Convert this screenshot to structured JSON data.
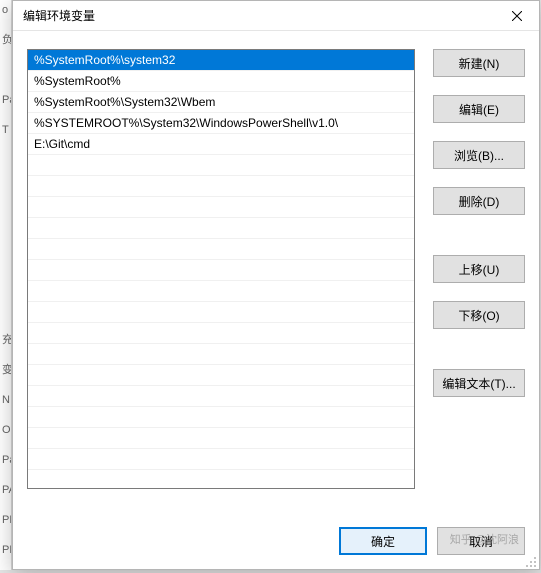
{
  "dialog": {
    "title": "编辑环境变量"
  },
  "list": {
    "items": [
      "%SystemRoot%\\system32",
      "%SystemRoot%",
      "%SystemRoot%\\System32\\Wbem",
      "%SYSTEMROOT%\\System32\\WindowsPowerShell\\v1.0\\",
      "E:\\Git\\cmd"
    ],
    "selected_index": 0,
    "visible_rows": 20
  },
  "buttons": {
    "new": "新建(N)",
    "edit": "编辑(E)",
    "browse": "浏览(B)...",
    "delete": "删除(D)",
    "move_up": "上移(U)",
    "move_down": "下移(O)",
    "edit_text": "编辑文本(T)...",
    "ok": "确定",
    "cancel": "取消"
  },
  "watermark": "知乎 @沈阿浪",
  "bg_fragments": [
    "o",
    "负",
    "",
    "Pa",
    "T",
    "",
    "",
    "",
    "",
    "",
    "",
    "充",
    "变",
    "N",
    "O",
    "Pa",
    "PA",
    "PF",
    "PF"
  ]
}
